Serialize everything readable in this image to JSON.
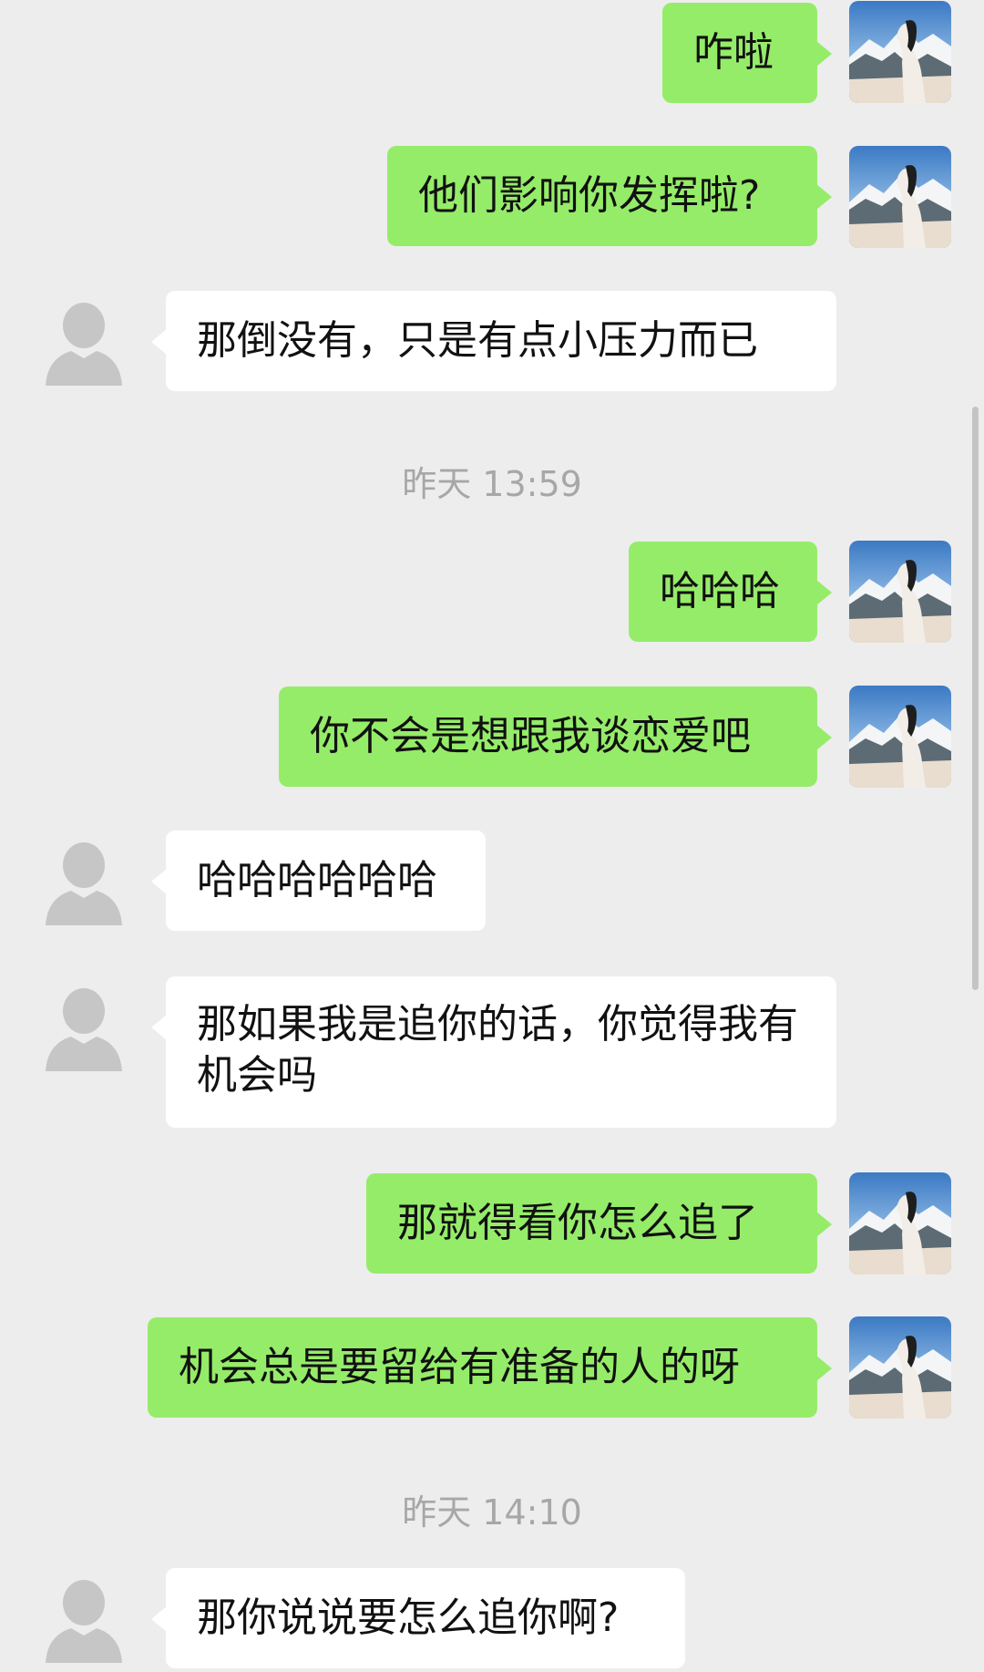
{
  "messages": [
    {
      "side": "sent",
      "text": "咋啦"
    },
    {
      "side": "sent",
      "text": "他们影响你发挥啦?"
    },
    {
      "side": "recv",
      "text": "那倒没有，只是有点小压力而已"
    },
    {
      "timestamp": "昨天 13:59"
    },
    {
      "side": "sent",
      "text": "哈哈哈"
    },
    {
      "side": "sent",
      "text": "你不会是想跟我谈恋爱吧"
    },
    {
      "side": "recv",
      "text": "哈哈哈哈哈哈"
    },
    {
      "side": "recv",
      "text": "那如果我是追你的话，你觉得我有机会吗"
    },
    {
      "side": "sent",
      "text": "那就得看你怎么追了"
    },
    {
      "side": "sent",
      "text": "机会总是要留给有准备的人的呀"
    },
    {
      "timestamp": "昨天 14:10"
    },
    {
      "side": "recv",
      "text": "那你说说要怎么追你啊?"
    }
  ],
  "colors": {
    "background": "#ededed",
    "sent_bubble": "#95ec69",
    "recv_bubble": "#ffffff",
    "timestamp_text": "#a7a7a7"
  },
  "icons": {
    "own_avatar": "photo-avatar-icon",
    "contact_avatar": "default-user-avatar-icon"
  }
}
